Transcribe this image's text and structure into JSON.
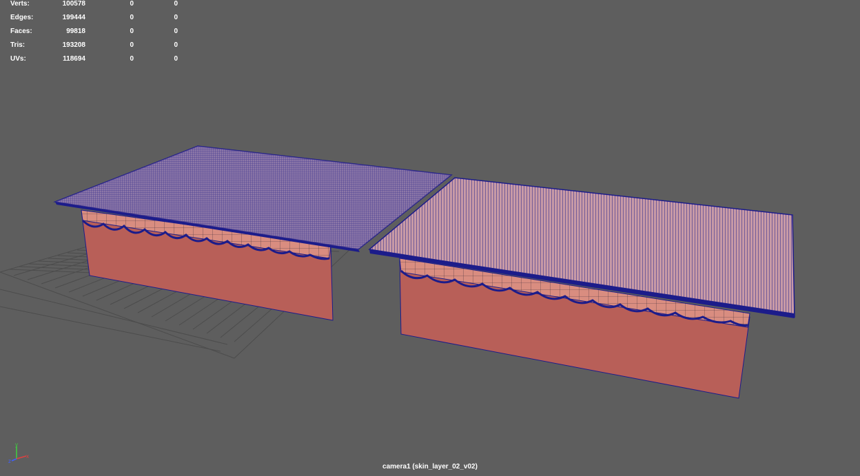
{
  "hud": {
    "rows": [
      {
        "label": "Verts:",
        "total": "100578",
        "sel1": "0",
        "sel2": "0"
      },
      {
        "label": "Edges:",
        "total": "199444",
        "sel1": "0",
        "sel2": "0"
      },
      {
        "label": "Faces:",
        "total": "99818",
        "sel1": "0",
        "sel2": "0"
      },
      {
        "label": "Tris:",
        "total": "193208",
        "sel1": "0",
        "sel2": "0"
      },
      {
        "label": "UVs:",
        "total": "118694",
        "sel1": "0",
        "sel2": "0"
      }
    ]
  },
  "camera": {
    "label": "camera1 (skin_layer_02_v02)"
  },
  "axis": {
    "y": "y",
    "x": "x",
    "z": "z"
  },
  "colors": {
    "background": "#5e5e5e",
    "wireframe": "#1c1c8a",
    "skin": "#b85f58",
    "skin_light": "#d98d80",
    "top_surface": "#c89aa6",
    "grid": "#4c4c4c"
  }
}
